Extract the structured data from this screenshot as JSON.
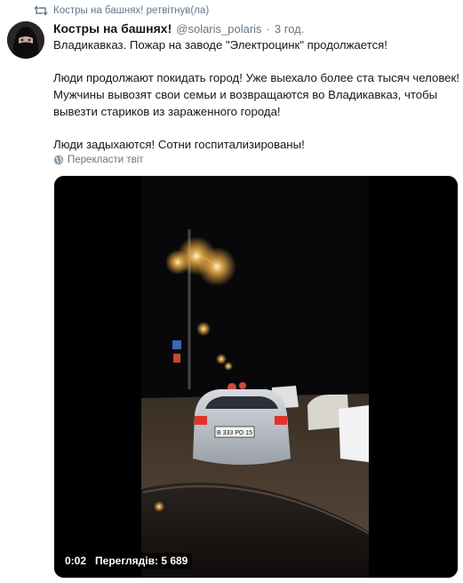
{
  "retweet": {
    "text": "Костры на башнях! ретвітнув(ла)",
    "icon": "retweet-icon"
  },
  "tweet": {
    "author_name": "Костры на башнях!",
    "handle": "@solaris_polaris",
    "separator": "·",
    "time": "3 год.",
    "lines": [
      "Владикавказ. Пожар на заводе \"Электроцинк\" продолжается!",
      "Люди продолжают покидать город! Уже выехало более ста тысяч человек!",
      "Мужчины вывозят свои семьи и возвращаются во Владикавказ, чтобы",
      "вывезти стариков из зараженного города!",
      "Люди задыхаются! Сотни госпитализированы!"
    ],
    "translate_label": "Перекласти твіт"
  },
  "video": {
    "duration": "0:02",
    "views": "Переглядів: 5 689",
    "license_plate": "В 333 РО 15"
  },
  "colors": {
    "text": "#14171a",
    "muted": "#657786",
    "border": "#e6ecf0"
  }
}
